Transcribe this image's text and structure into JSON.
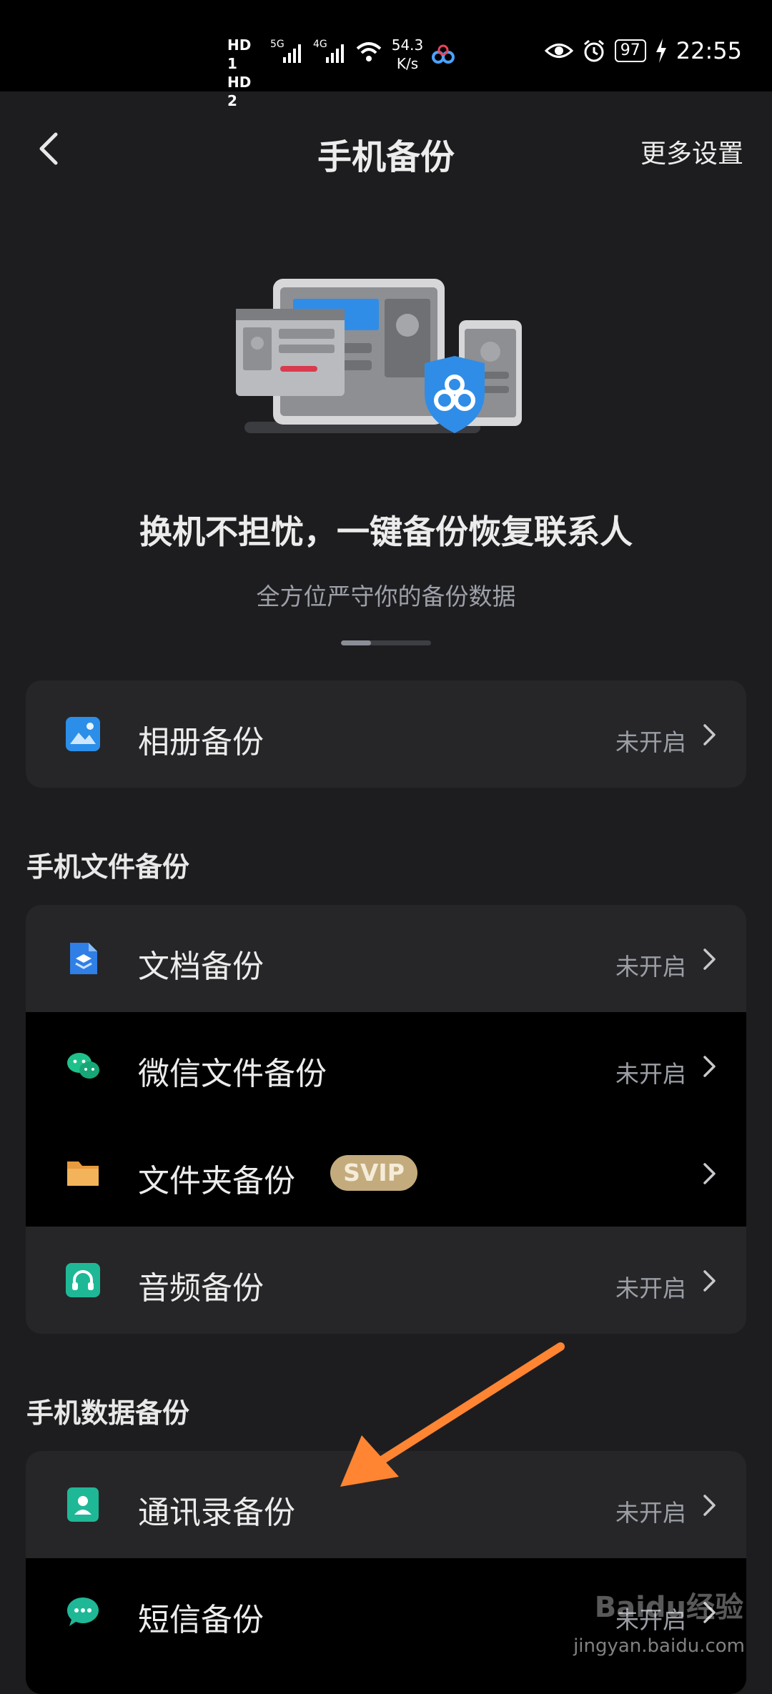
{
  "status_bar": {
    "sim1": "HD 1",
    "sim2": "HD 2",
    "net5g": "5G",
    "net4g": "4G",
    "speed_value": "54.3",
    "speed_unit": "K/s",
    "battery": "97",
    "time": "22:55"
  },
  "header": {
    "title": "手机备份",
    "more_settings": "更多设置"
  },
  "hero": {
    "title": "换机不担忧，一键备份恢复联系人",
    "subtitle": "全方位严守你的备份数据",
    "pager": {
      "pages": 3,
      "active_index": 0
    }
  },
  "photo_backup": {
    "label": "相册备份",
    "status": "未开启",
    "icon": "photo-icon"
  },
  "file_section": {
    "title": "手机文件备份",
    "items": [
      {
        "label": "文档备份",
        "status": "未开启",
        "icon": "document-icon"
      },
      {
        "label": "微信文件备份",
        "status": "未开启",
        "icon": "wechat-icon"
      },
      {
        "label": "文件夹备份",
        "status": "",
        "badge": "SVIP",
        "icon": "folder-icon"
      },
      {
        "label": "音频备份",
        "status": "未开启",
        "icon": "headphones-icon"
      }
    ]
  },
  "data_section": {
    "title": "手机数据备份",
    "items": [
      {
        "label": "通讯录备份",
        "status": "未开启",
        "icon": "contacts-icon"
      },
      {
        "label": "短信备份",
        "status": "未开启",
        "icon": "sms-icon"
      }
    ]
  },
  "watermark": {
    "text": "Baidu经验",
    "url": "jingyan.baidu.com"
  },
  "colors": {
    "background": "#1d1d1f",
    "card": "#262628",
    "accent_blue": "#2f8de8",
    "arrow": "#ff8533",
    "svip": "#c4ab7d"
  }
}
